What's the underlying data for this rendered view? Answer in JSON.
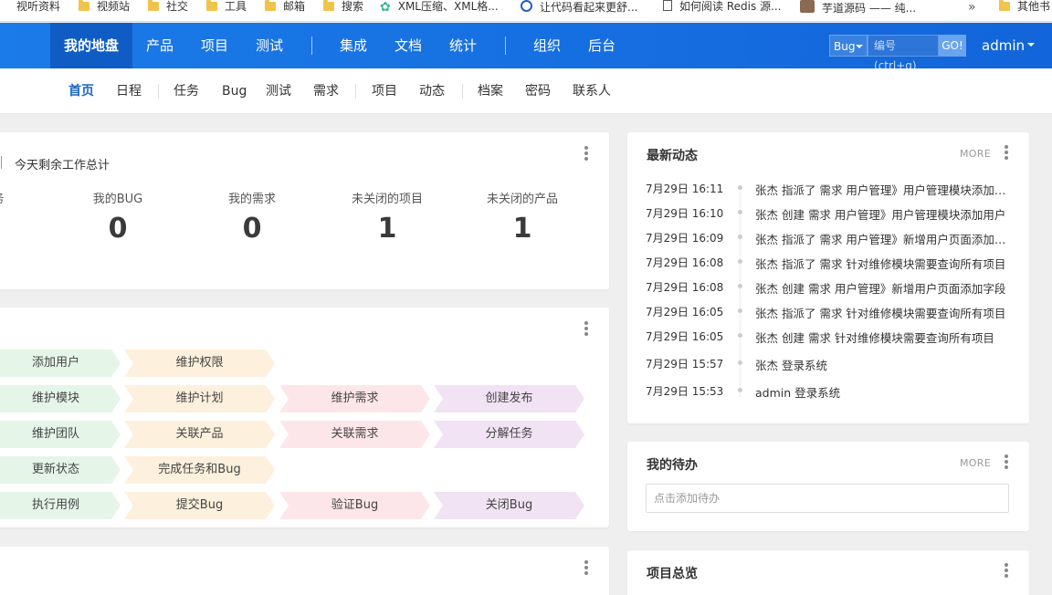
{
  "bookmarks": [
    {
      "label": "视听资料",
      "icon": "folder-icon"
    },
    {
      "label": "视频站",
      "icon": "folder-icon"
    },
    {
      "label": "社交",
      "icon": "folder-icon"
    },
    {
      "label": "工具",
      "icon": "folder-icon"
    },
    {
      "label": "邮箱",
      "icon": "folder-icon"
    },
    {
      "label": "搜索",
      "icon": "folder-icon"
    },
    {
      "label": "XML压缩、XML格...",
      "icon": "gear-icon"
    },
    {
      "label": "让代码看起来更舒...",
      "icon": "circle-icon"
    },
    {
      "label": "如何阅读 Redis 源...",
      "icon": "document-icon"
    },
    {
      "label": "芋道源码 —— 纯...",
      "icon": "avatar-icon"
    },
    {
      "label": "其他书",
      "icon": "folder-icon"
    }
  ],
  "bookmarks_more": "»",
  "nav": {
    "items": [
      "我的地盘",
      "产品",
      "项目",
      "测试",
      "集成",
      "文档",
      "统计",
      "组织",
      "后台"
    ],
    "active": "我的地盘",
    "search_type": "Bug",
    "search_placeholder": "编号(ctrl+g)",
    "go_label": "GO!",
    "user": "admin"
  },
  "subnav": {
    "items": [
      "首页",
      "日程",
      "任务",
      "Bug",
      "测试",
      "需求",
      "项目",
      "动态",
      "档案",
      "密码",
      "联系人"
    ],
    "active": "首页"
  },
  "stats": {
    "title": "今天剩余工作总计",
    "partial_label": "务",
    "items": [
      {
        "label": "我的BUG",
        "value": "0"
      },
      {
        "label": "我的需求",
        "value": "0"
      },
      {
        "label": "未关闭的项目",
        "value": "1"
      },
      {
        "label": "未关闭的产品",
        "value": "1"
      }
    ]
  },
  "flow": {
    "rows": [
      [
        "添加用户",
        "维护权限"
      ],
      [
        "维护模块",
        "维护计划",
        "维护需求",
        "创建发布"
      ],
      [
        "维护团队",
        "关联产品",
        "关联需求",
        "分解任务"
      ],
      [
        "更新状态",
        "完成任务和Bug"
      ],
      [
        "执行用例",
        "提交Bug",
        "验证Bug",
        "关闭Bug"
      ]
    ],
    "colors": {
      "green": "#e5f5e8",
      "orange": "#fdf0dc",
      "pink": "#fde6ea",
      "purple": "#f1e2f4"
    }
  },
  "activity": {
    "title": "最新动态",
    "more": "MORE",
    "items": [
      {
        "time": "7月29日 16:11",
        "text": "张杰 指派了 需求 用户管理》用户管理模块添加用户"
      },
      {
        "time": "7月29日 16:10",
        "text": "张杰 创建 需求 用户管理》用户管理模块添加用户"
      },
      {
        "time": "7月29日 16:09",
        "text": "张杰 指派了 需求 用户管理》新增用户页面添加字段"
      },
      {
        "time": "7月29日 16:08",
        "text": "张杰 指派了 需求 针对维修模块需要查询所有项目"
      },
      {
        "time": "7月29日 16:08",
        "text": "张杰 创建 需求 用户管理》新增用户页面添加字段"
      },
      {
        "time": "7月29日 16:05",
        "text": "张杰 指派了 需求 针对维修模块需要查询所有项目"
      },
      {
        "time": "7月29日 16:05",
        "text": "张杰 创建 需求 针对维修模块需要查询所有项目"
      },
      {
        "time": "7月29日 15:57",
        "text": "张杰 登录系统"
      },
      {
        "time": "7月29日 15:53",
        "text": "admin 登录系统"
      }
    ]
  },
  "todo": {
    "title": "我的待办",
    "more": "MORE",
    "placeholder": "点击添加待办"
  },
  "project_overview": {
    "title": "项目总览"
  },
  "colors": {
    "nav_bg": "#1b7be8",
    "nav_active": "#0f5dc4",
    "subnav_active": "#1a66c6",
    "page_bg": "#efefef"
  }
}
